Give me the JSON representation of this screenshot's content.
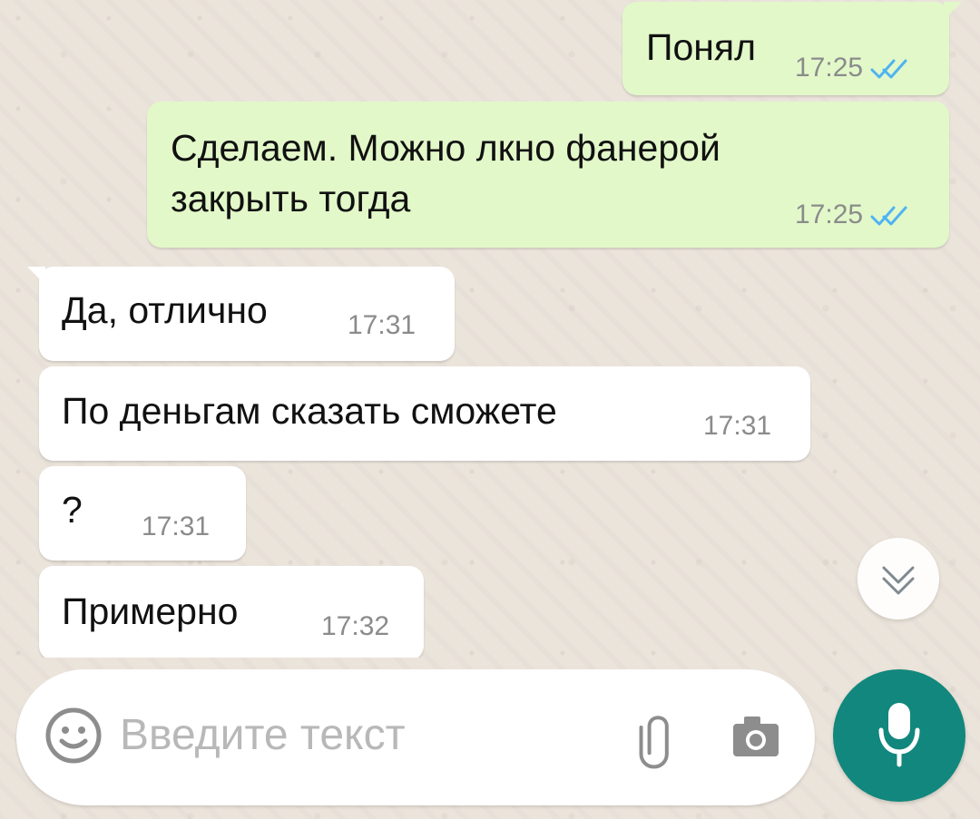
{
  "messages": [
    {
      "text_lines": [
        "Понял"
      ],
      "time": "17:25",
      "direction": "outgoing",
      "status": "read"
    },
    {
      "text_lines": [
        "Сделаем. Можно лкно фанерой",
        "закрыть тогда"
      ],
      "time": "17:25",
      "direction": "outgoing",
      "status": "read"
    },
    {
      "text_lines": [
        "Да, отлично"
      ],
      "time": "17:31",
      "direction": "incoming"
    },
    {
      "text_lines": [
        "По деньгам сказать сможете"
      ],
      "time": "17:31",
      "direction": "incoming"
    },
    {
      "text_lines": [
        "?"
      ],
      "time": "17:31",
      "direction": "incoming"
    },
    {
      "text_lines": [
        "Примерно"
      ],
      "time": "17:32",
      "direction": "incoming"
    }
  ],
  "composer": {
    "placeholder": "Введите текст",
    "icons": {
      "emoji": "emoji-icon",
      "attach": "paperclip-icon",
      "camera": "camera-icon",
      "mic": "microphone-icon"
    }
  },
  "scroll_button": {
    "icon": "double-chevron-down-icon"
  },
  "colors": {
    "outgoing_bubble": "#e2f8c9",
    "incoming_bubble": "#ffffff",
    "tick_blue": "#4fb3f2",
    "mic_button": "#12877d"
  }
}
